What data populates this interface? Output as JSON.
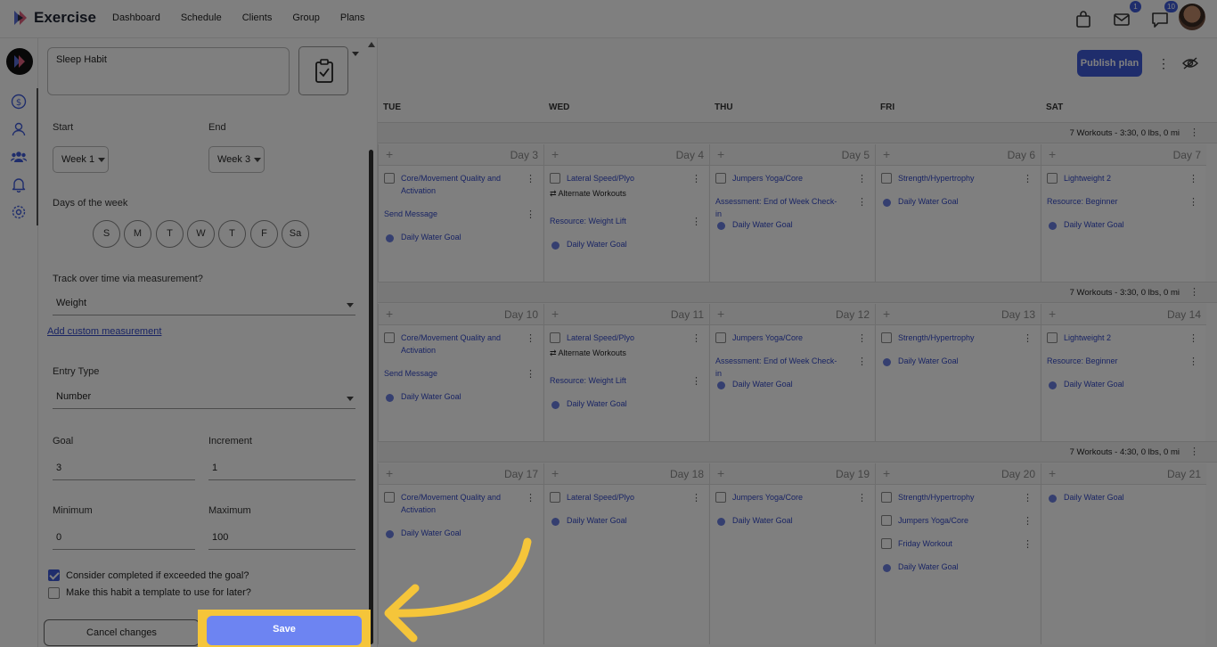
{
  "app": {
    "title": "Exercise",
    "nav": [
      "Dashboard",
      "Schedule",
      "Clients",
      "Group",
      "Plans"
    ],
    "badges": {
      "mail": "1",
      "chat": "10"
    }
  },
  "form": {
    "habit_name": "Sleep Habit",
    "start_label": "Start",
    "end_label": "End",
    "start_value": "Week 1",
    "end_value": "Week 3",
    "days_label": "Days of the week",
    "days": [
      "S",
      "M",
      "T",
      "W",
      "T",
      "F",
      "Sa"
    ],
    "track_label": "Track over time via measurement?",
    "track_value": "Weight",
    "add_custom_link": "Add custom measurement",
    "entry_type_label": "Entry Type",
    "entry_type_value": "Number",
    "goal_label": "Goal",
    "goal_value": "3",
    "increment_label": "Increment",
    "increment_value": "1",
    "minimum_label": "Minimum",
    "minimum_value": "0",
    "maximum_label": "Maximum",
    "maximum_value": "100",
    "check_exceeded": "Consider completed if exceeded the goal?",
    "check_exceeded_checked": true,
    "check_template": "Make this habit a template to use for later?",
    "check_template_checked": false,
    "cancel_label": "Cancel changes",
    "save_label": "Save"
  },
  "calendar": {
    "publish_label": "Publish plan",
    "headers": [
      "TUE",
      "WED",
      "THU",
      "FRI",
      "SAT"
    ],
    "weeks": [
      {
        "summary": "7 Workouts - 3:30, 0 lbs, 0 mi",
        "days": [
          {
            "label": "Day 3",
            "items": [
              {
                "type": "workout",
                "text": "Core/Movement Quality and Activation"
              },
              {
                "type": "plain",
                "text": "Send Message"
              },
              {
                "type": "dot",
                "text": "Daily Water Goal"
              }
            ]
          },
          {
            "label": "Day 4",
            "items": [
              {
                "type": "workout",
                "text": "Lateral Speed/Plyo",
                "alt": "Alternate Workouts"
              },
              {
                "type": "plain",
                "text": "Resource: Weight Lift"
              },
              {
                "type": "dot",
                "text": "Daily Water Goal"
              }
            ]
          },
          {
            "label": "Day 5",
            "items": [
              {
                "type": "workout",
                "text": "Jumpers Yoga/Core"
              },
              {
                "type": "plain",
                "text": "Assessment: End of Week Check-in"
              },
              {
                "type": "dot",
                "text": "Daily Water Goal"
              }
            ]
          },
          {
            "label": "Day 6",
            "items": [
              {
                "type": "workout",
                "text": "Strength/Hypertrophy"
              },
              {
                "type": "dot",
                "text": "Daily Water Goal"
              }
            ]
          },
          {
            "label": "Day 7",
            "items": [
              {
                "type": "workout",
                "text": "Lightweight 2"
              },
              {
                "type": "plain",
                "text": "Resource: Beginner"
              },
              {
                "type": "dot",
                "text": "Daily Water Goal"
              }
            ]
          }
        ]
      },
      {
        "summary": "7 Workouts - 3:30, 0 lbs, 0 mi",
        "days": [
          {
            "label": "Day 10",
            "items": [
              {
                "type": "workout",
                "text": "Core/Movement Quality and Activation"
              },
              {
                "type": "plain",
                "text": "Send Message"
              },
              {
                "type": "dot",
                "text": "Daily Water Goal"
              }
            ]
          },
          {
            "label": "Day 11",
            "items": [
              {
                "type": "workout",
                "text": "Lateral Speed/Plyo",
                "alt": "Alternate Workouts"
              },
              {
                "type": "plain",
                "text": "Resource: Weight Lift"
              },
              {
                "type": "dot",
                "text": "Daily Water Goal"
              }
            ]
          },
          {
            "label": "Day 12",
            "items": [
              {
                "type": "workout",
                "text": "Jumpers Yoga/Core"
              },
              {
                "type": "plain",
                "text": "Assessment: End of Week Check-in"
              },
              {
                "type": "dot",
                "text": "Daily Water Goal"
              }
            ]
          },
          {
            "label": "Day 13",
            "items": [
              {
                "type": "workout",
                "text": "Strength/Hypertrophy"
              },
              {
                "type": "dot",
                "text": "Daily Water Goal"
              }
            ]
          },
          {
            "label": "Day 14",
            "items": [
              {
                "type": "workout",
                "text": "Lightweight 2"
              },
              {
                "type": "plain",
                "text": "Resource: Beginner"
              },
              {
                "type": "dot",
                "text": "Daily Water Goal"
              }
            ]
          }
        ]
      },
      {
        "summary": "7 Workouts - 4:30, 0 lbs, 0 mi",
        "days": [
          {
            "label": "Day 17",
            "items": [
              {
                "type": "workout",
                "text": "Core/Movement Quality and Activation"
              },
              {
                "type": "dot",
                "text": "Daily Water Goal"
              }
            ]
          },
          {
            "label": "Day 18",
            "items": [
              {
                "type": "workout",
                "text": "Lateral Speed/Plyo"
              },
              {
                "type": "dot",
                "text": "Daily Water Goal"
              }
            ]
          },
          {
            "label": "Day 19",
            "items": [
              {
                "type": "workout",
                "text": "Jumpers Yoga/Core"
              },
              {
                "type": "dot",
                "text": "Daily Water Goal"
              }
            ]
          },
          {
            "label": "Day 20",
            "items": [
              {
                "type": "workout",
                "text": "Strength/Hypertrophy"
              },
              {
                "type": "workout",
                "text": "Jumpers Yoga/Core"
              },
              {
                "type": "workout",
                "text": "Friday Workout"
              },
              {
                "type": "dot",
                "text": "Daily Water Goal"
              }
            ]
          },
          {
            "label": "Day 21",
            "items": [
              {
                "type": "dot",
                "text": "Daily Water Goal"
              }
            ]
          }
        ]
      }
    ]
  }
}
